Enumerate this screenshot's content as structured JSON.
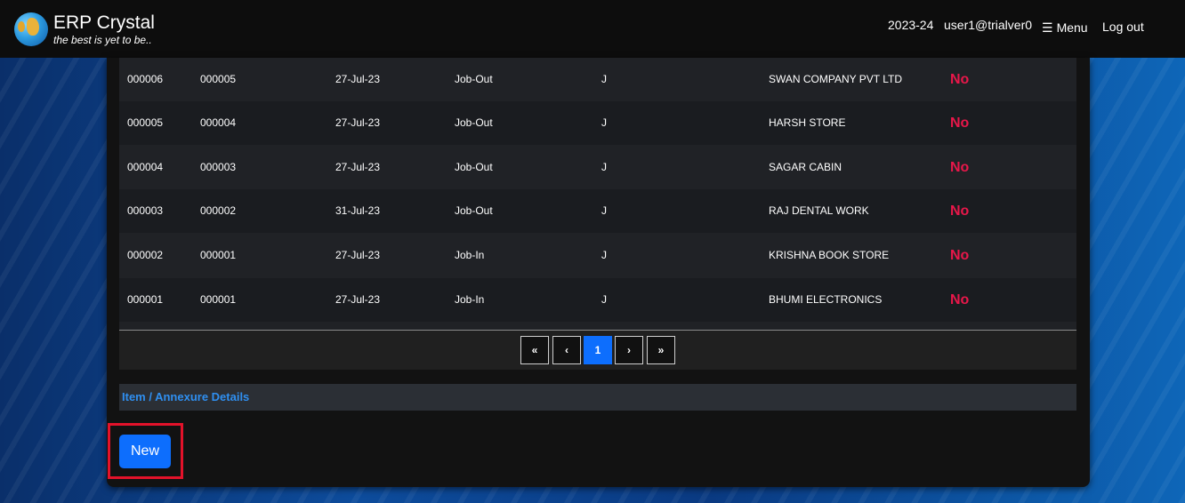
{
  "header": {
    "brand_title": "ERP Crystal",
    "brand_tagline": "the best is yet to be..",
    "financial_year": "2023-24",
    "user": "user1@trialver0",
    "menu_label": "Menu",
    "logout_label": "Log out"
  },
  "table": {
    "rows": [
      {
        "c1": "000006",
        "c2": "000005",
        "date": "27-Jul-23",
        "type": "Job-Out",
        "code": "J",
        "party": "SWAN COMPANY PVT LTD",
        "status": "No"
      },
      {
        "c1": "000005",
        "c2": "000004",
        "date": "27-Jul-23",
        "type": "Job-Out",
        "code": "J",
        "party": "HARSH STORE",
        "status": "No"
      },
      {
        "c1": "000004",
        "c2": "000003",
        "date": "27-Jul-23",
        "type": "Job-Out",
        "code": "J",
        "party": "SAGAR CABIN",
        "status": "No"
      },
      {
        "c1": "000003",
        "c2": "000002",
        "date": "31-Jul-23",
        "type": "Job-Out",
        "code": "J",
        "party": "RAJ DENTAL WORK",
        "status": "No"
      },
      {
        "c1": "000002",
        "c2": "000001",
        "date": "27-Jul-23",
        "type": "Job-In",
        "code": "J",
        "party": "KRISHNA BOOK STORE",
        "status": "No"
      },
      {
        "c1": "000001",
        "c2": "000001",
        "date": "27-Jul-23",
        "type": "Job-In",
        "code": "J",
        "party": "BHUMI ELECTRONICS",
        "status": "No"
      }
    ]
  },
  "pagination": {
    "first": "«",
    "prev": "‹",
    "current": "1",
    "next": "›",
    "last": "»"
  },
  "section": {
    "title": "Item / Annexure Details"
  },
  "actions": {
    "new_label": "New"
  },
  "colors": {
    "accent": "#0d6efd",
    "status_no": "#e8174a",
    "highlight_box": "#e3122a"
  }
}
